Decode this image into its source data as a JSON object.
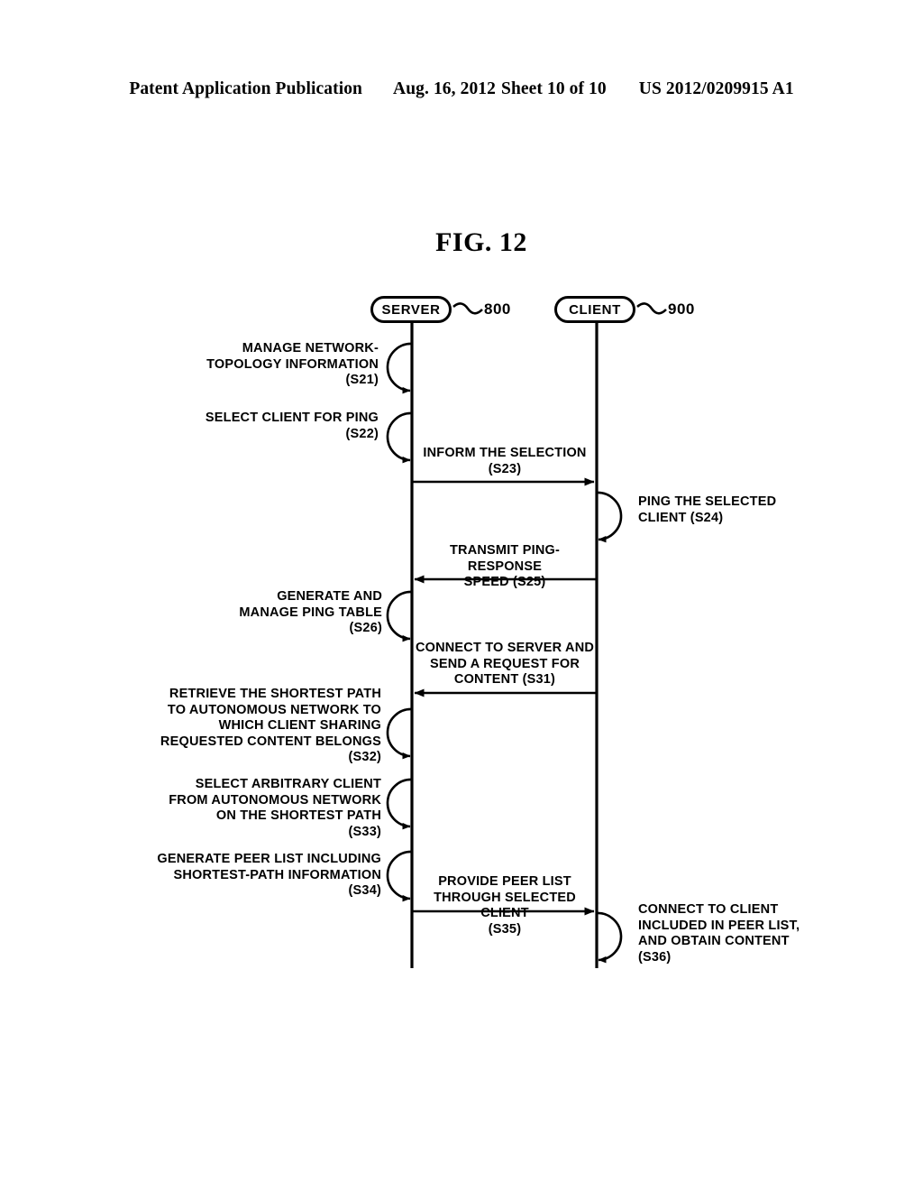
{
  "header": {
    "publication": "Patent Application Publication",
    "date": "Aug. 16, 2012",
    "sheet": "Sheet 10 of 10",
    "doc_number": "US 2012/0209915 A1"
  },
  "figure": {
    "title": "FIG. 12"
  },
  "lifelines": [
    {
      "id": "server",
      "label": "SERVER",
      "ref": "800"
    },
    {
      "id": "client",
      "label": "CLIENT",
      "ref": "900"
    }
  ],
  "steps": {
    "s21": "MANAGE NETWORK-\nTOPOLOGY INFORMATION\n(S21)",
    "s22": "SELECT CLIENT FOR PING\n(S22)",
    "s23": "INFORM THE SELECTION\n(S23)",
    "s24": "PING THE SELECTED\nCLIENT (S24)",
    "s25": "TRANSMIT PING-RESPONSE\nSPEED (S25)",
    "s26": "GENERATE AND\nMANAGE PING TABLE\n(S26)",
    "s31": "CONNECT TO SERVER AND\nSEND A REQUEST FOR\nCONTENT (S31)",
    "s32": "RETRIEVE THE SHORTEST PATH\nTO AUTONOMOUS NETWORK TO\nWHICH CLIENT SHARING\nREQUESTED CONTENT BELONGS\n(S32)",
    "s33": "SELECT ARBITRARY CLIENT\nFROM AUTONOMOUS NETWORK\nON THE SHORTEST PATH\n(S33)",
    "s34": "GENERATE PEER LIST INCLUDING\nSHORTEST-PATH INFORMATION\n(S34)",
    "s35": "PROVIDE PEER LIST\nTHROUGH SELECTED CLIENT\n(S35)",
    "s36": "CONNECT TO CLIENT\nINCLUDED IN PEER LIST,\nAND OBTAIN CONTENT\n(S36)"
  },
  "colors": {
    "ink": "#000000",
    "paper": "#ffffff"
  }
}
